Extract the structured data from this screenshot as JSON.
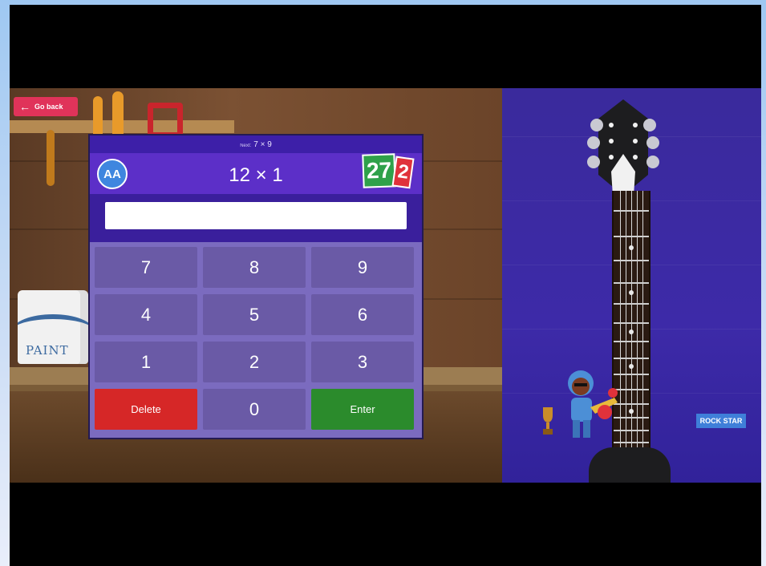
{
  "game": {
    "back_label": "Go back",
    "next_question": "7 × 9",
    "next_prefix": "Next:",
    "current_question": "12 × 1",
    "player_initials": "AA",
    "score_part1": "27",
    "score_part2": "2",
    "answer_value": "",
    "keypad": {
      "k7": "7",
      "k8": "8",
      "k9": "9",
      "k4": "4",
      "k5": "5",
      "k6": "6",
      "k1": "1",
      "k2": "2",
      "k3": "3",
      "delete": "Delete",
      "k0": "0",
      "enter": "Enter"
    },
    "rank_label": "ROCK STAR",
    "paint_label": "PAINT"
  },
  "colors": {
    "header_purple": "#5c2fc8",
    "key_purple": "#6a5aa6",
    "delete_red": "#d62727",
    "enter_green": "#2b8b2c",
    "back_pink": "#e0335a",
    "panel_indigo": "#3d2aa8"
  },
  "icons": [
    "back-arrow-icon",
    "player-avatar-icon",
    "guitar-icon",
    "trophy-icon",
    "rocker-character-icon",
    "paint-can-icon"
  ]
}
